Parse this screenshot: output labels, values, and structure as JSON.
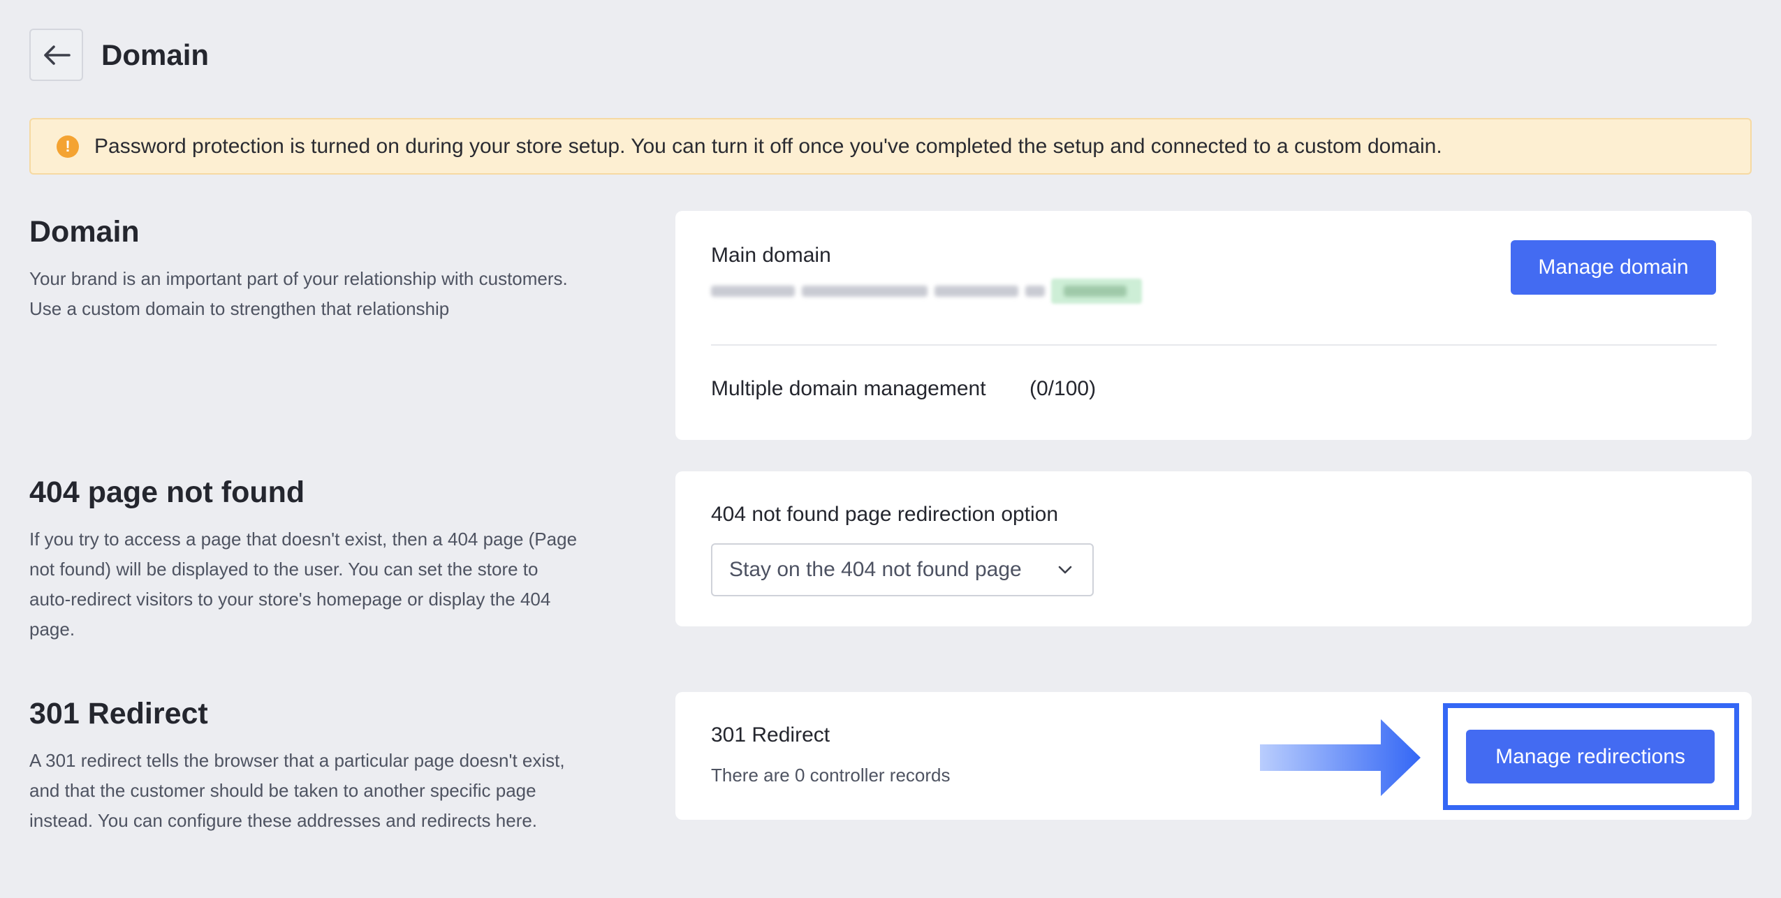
{
  "header": {
    "title": "Domain"
  },
  "banner": {
    "icon": "exclamation-circle-icon",
    "icon_glyph": "!",
    "text": "Password protection is turned on during your store setup. You can turn it off once you've completed the setup and connected to a custom domain."
  },
  "sections": {
    "domain": {
      "title": "Domain",
      "description": "Your brand is an important part of your relationship with customers. Use a custom domain to strengthen that relationship"
    },
    "not_found": {
      "title": "404 page not found",
      "description": "If you try to access a page that doesn't exist, then a 404 page (Page not found) will be displayed to the user. You can set the store to auto-redirect visitors to your store's homepage or display the 404 page."
    },
    "redirect": {
      "title": "301 Redirect",
      "description": "A 301 redirect tells the browser that a particular page doesn't exist, and that the customer should be taken to another specific page instead. You can configure these addresses and redirects here."
    }
  },
  "domain_card": {
    "main_domain_label": "Main domain",
    "manage_domain_button": "Manage domain",
    "multiple_domain_label": "Multiple domain management",
    "multiple_domain_count": "(0/100)"
  },
  "not_found_card": {
    "option_label": "404 not found page redirection option",
    "selected_option": "Stay on the 404 not found page"
  },
  "redirect_card": {
    "title": "301 Redirect",
    "records_text": "There are 0 controller records",
    "manage_redirections_button": "Manage redirections"
  },
  "colors": {
    "primary": "#436bf2",
    "highlight": "#3467f5",
    "banner_bg": "#fdefd2",
    "warning_icon": "#f4a332",
    "page_bg": "#ecedf1"
  }
}
